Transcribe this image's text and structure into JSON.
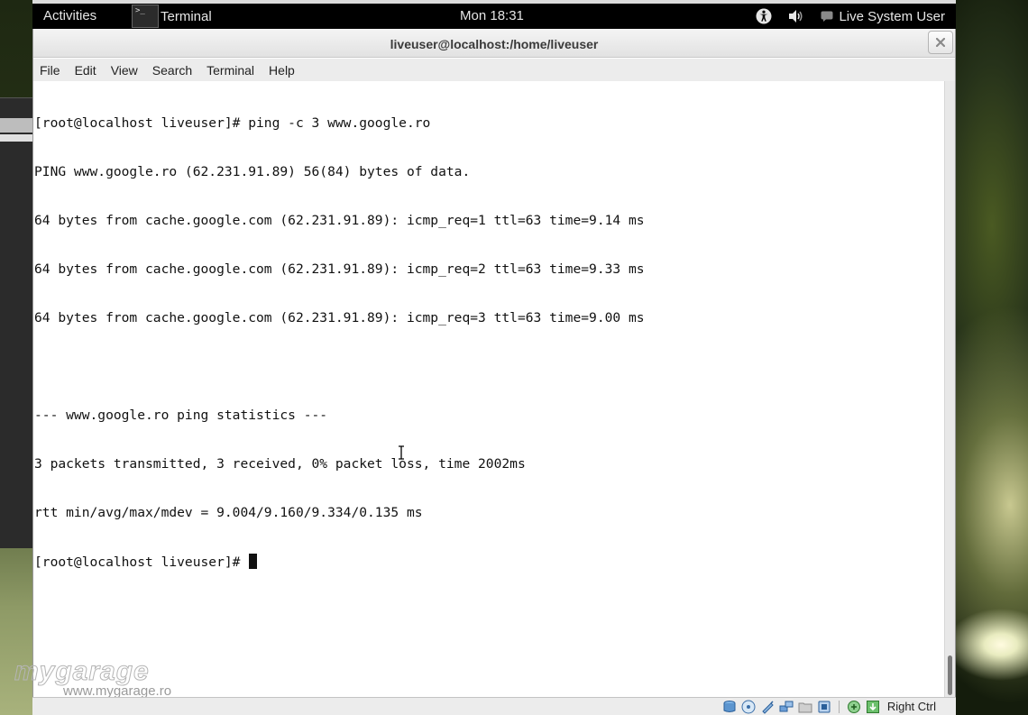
{
  "top_panel": {
    "activities_label": "Activities",
    "app_name": "Terminal",
    "app_icon_glyph": ">_",
    "clock": "Mon 18:31",
    "user_name": "Live System User",
    "icons": [
      "accessibility-icon",
      "volume-icon",
      "user-status-icon"
    ]
  },
  "window": {
    "title": "liveuser@localhost:/home/liveuser",
    "close_icon": "close-icon"
  },
  "menubar": {
    "items": [
      {
        "label": "File"
      },
      {
        "label": "Edit"
      },
      {
        "label": "View"
      },
      {
        "label": "Search"
      },
      {
        "label": "Terminal"
      },
      {
        "label": "Help"
      }
    ]
  },
  "terminal": {
    "lines": [
      "[root@localhost liveuser]# ping -c 3 www.google.ro",
      "PING www.google.ro (62.231.91.89) 56(84) bytes of data.",
      "64 bytes from cache.google.com (62.231.91.89): icmp_req=1 ttl=63 time=9.14 ms",
      "64 bytes from cache.google.com (62.231.91.89): icmp_req=2 ttl=63 time=9.33 ms",
      "64 bytes from cache.google.com (62.231.91.89): icmp_req=3 ttl=63 time=9.00 ms",
      "",
      "--- www.google.ro ping statistics ---",
      "3 packets transmitted, 3 received, 0% packet loss, time 2002ms",
      "rtt min/avg/max/mdev = 9.004/9.160/9.334/0.135 ms"
    ],
    "prompt": "[root@localhost liveuser]# "
  },
  "watermark": {
    "logo": "mygarage",
    "url": "www.mygarage.ro"
  },
  "vbox_statusbar": {
    "icons": [
      "hard-disk-icon",
      "optical-drive-icon",
      "usb-icon",
      "network-icon",
      "shared-folders-icon",
      "video-capture-icon",
      "mouse-integration-icon",
      "keyboard-capture-icon"
    ],
    "host_key": "Right Ctrl"
  },
  "colors": {
    "panel_bg": "#000000",
    "terminal_bg": "#ffffff",
    "terminal_fg": "#111111",
    "titlebar_bg": "#e8e8e8"
  }
}
